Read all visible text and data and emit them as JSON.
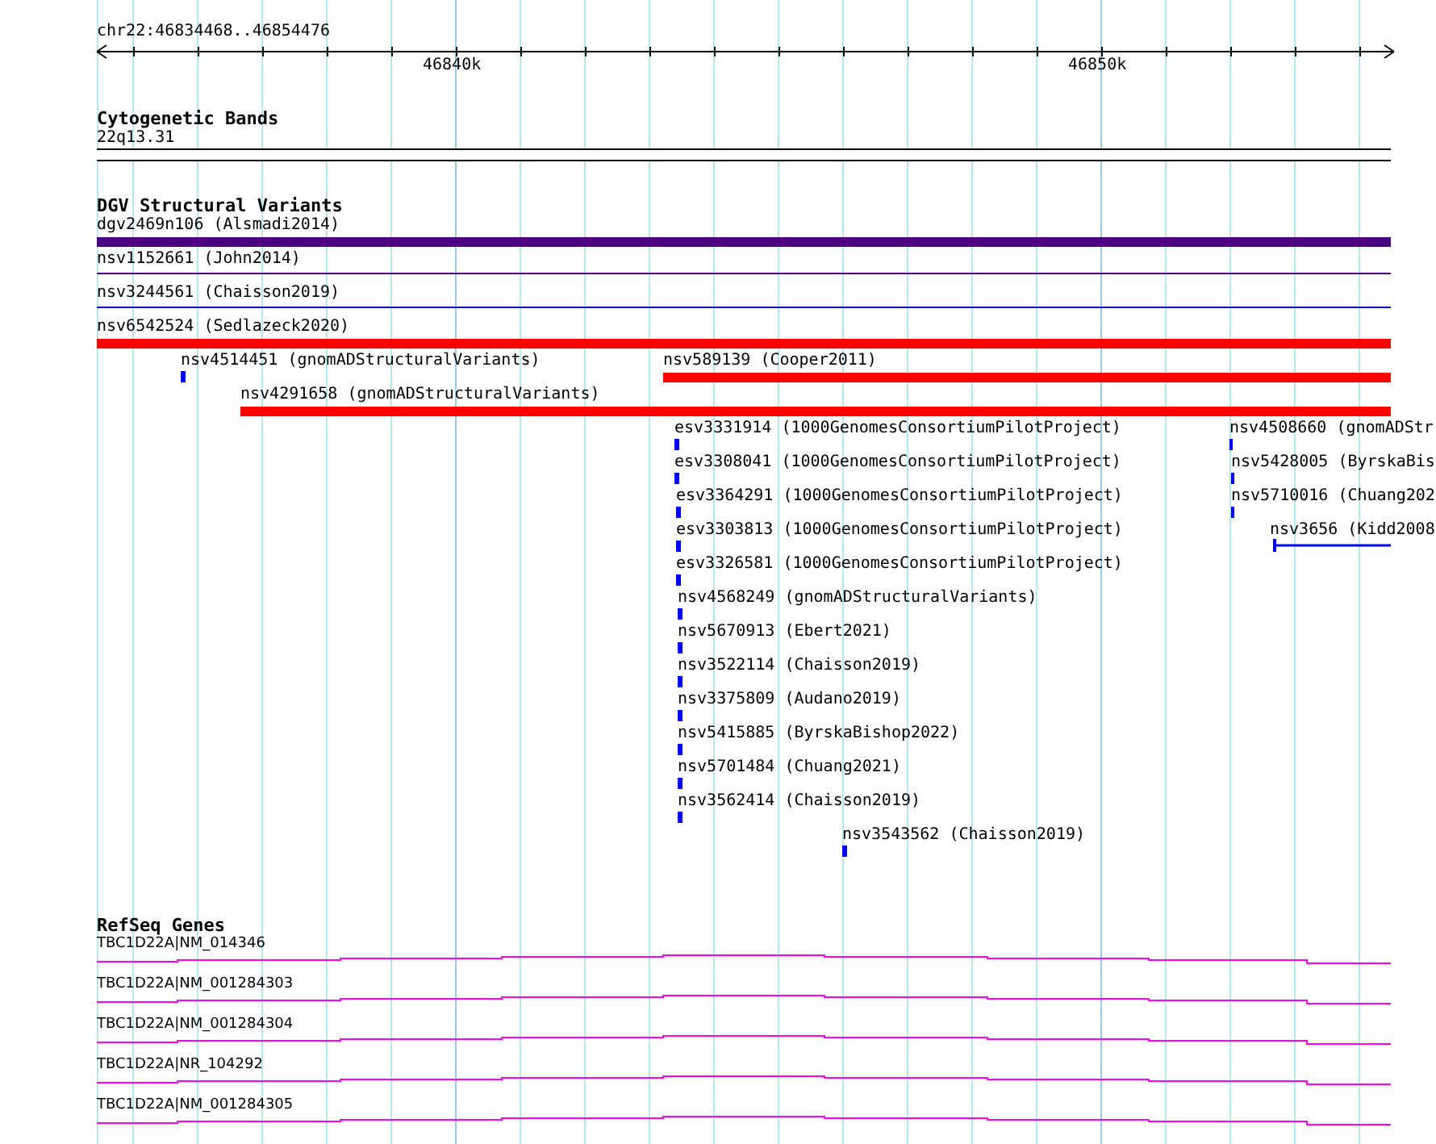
{
  "ruler": {
    "location": "chr22:46834468..46854476",
    "tick_labels": [
      "46840k",
      "46850k"
    ]
  },
  "tracks": [
    {
      "title": "Cytogenetic Bands",
      "kind": "bands",
      "features": [
        {
          "label": "22q13.31"
        }
      ]
    },
    {
      "title": "DGV Structural Variants",
      "kind": "variants",
      "features": [
        {
          "label": "dgv2469n106 (Alsmadi2014)",
          "kind": "bar",
          "color": "#4b0082"
        },
        {
          "label": "nsv1152661 (John2014)",
          "kind": "line",
          "color": "#4b0082"
        },
        {
          "label": "nsv3244561 (Chaisson2019)",
          "kind": "line",
          "color": "#0000cd"
        },
        {
          "label": "nsv6542524 (Sedlazeck2020)",
          "kind": "bar",
          "color": "#ff0000"
        },
        {
          "label": "nsv4514451 (gnomADStructuralVariants)",
          "kind": "point",
          "color": "#0000ff"
        },
        {
          "label": "nsv589139 (Cooper2011)",
          "kind": "bar",
          "color": "#ff0000"
        },
        {
          "label": "nsv4291658 (gnomADStructuralVariants)",
          "kind": "bar",
          "color": "#ff0000"
        },
        {
          "label": "esv3331914 (1000GenomesConsortiumPilotProject)",
          "kind": "point",
          "color": "#0000ff"
        },
        {
          "label": "nsv4508660 (gnomADStr",
          "kind": "point",
          "color": "#0000ff"
        },
        {
          "label": "esv3308041 (1000GenomesConsortiumPilotProject)",
          "kind": "point",
          "color": "#0000ff"
        },
        {
          "label": "nsv5428005 (ByrskaBis",
          "kind": "point",
          "color": "#0000ff"
        },
        {
          "label": "esv3364291 (1000GenomesConsortiumPilotProject)",
          "kind": "point",
          "color": "#0000ff"
        },
        {
          "label": "nsv5710016 (Chuang202",
          "kind": "point",
          "color": "#0000ff"
        },
        {
          "label": "esv3303813 (1000GenomesConsortiumPilotProject)",
          "kind": "point",
          "color": "#0000ff"
        },
        {
          "label": "nsv3656 (Kidd2008",
          "kind": "span",
          "color": "#0000ff"
        },
        {
          "label": "esv3326581 (1000GenomesConsortiumPilotProject)",
          "kind": "point",
          "color": "#0000ff"
        },
        {
          "label": "nsv4568249 (gnomADStructuralVariants)",
          "kind": "point",
          "color": "#0000ff"
        },
        {
          "label": "nsv5670913 (Ebert2021)",
          "kind": "point",
          "color": "#0000ff"
        },
        {
          "label": "nsv3522114 (Chaisson2019)",
          "kind": "point",
          "color": "#0000ff"
        },
        {
          "label": "nsv3375809 (Audano2019)",
          "kind": "point",
          "color": "#0000ff"
        },
        {
          "label": "nsv5415885 (ByrskaBishop2022)",
          "kind": "point",
          "color": "#0000ff"
        },
        {
          "label": "nsv5701484 (Chuang2021)",
          "kind": "point",
          "color": "#0000ff"
        },
        {
          "label": "nsv3562414 (Chaisson2019)",
          "kind": "point",
          "color": "#0000ff"
        },
        {
          "label": "nsv3543562 (Chaisson2019)",
          "kind": "point",
          "color": "#0000ff"
        }
      ]
    },
    {
      "title": "RefSeq Genes",
      "kind": "genes",
      "features": [
        {
          "label": "TBC1D22A|NM_014346"
        },
        {
          "label": "TBC1D22A|NM_001284303"
        },
        {
          "label": "TBC1D22A|NM_001284304"
        },
        {
          "label": "TBC1D22A|NR_104292"
        },
        {
          "label": "TBC1D22A|NM_001284305"
        }
      ]
    }
  ]
}
